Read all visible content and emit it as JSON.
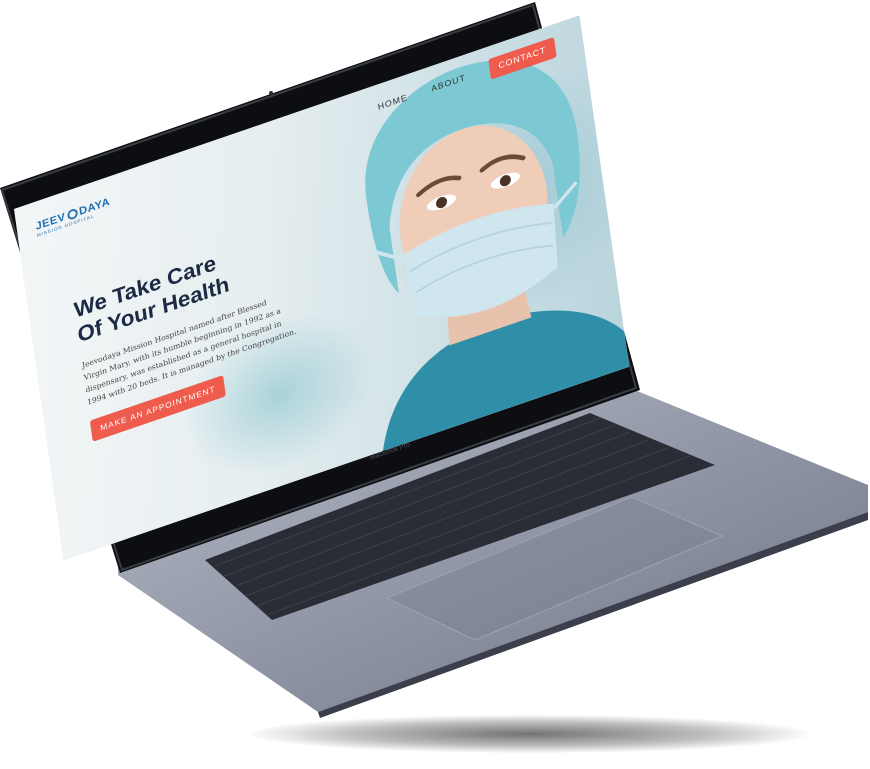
{
  "logo": {
    "name_left": "JEEV",
    "name_right": "DAYA",
    "subtitle": "MISSION HOSPITAL"
  },
  "nav": {
    "home": "HOME",
    "about": "ABOUT",
    "contact": "CONTACT"
  },
  "hero": {
    "title_line1": "We Take Care",
    "title_line2": "Of Your Health",
    "description": "Jeevodaya Mission Hospital named after Blessed Virgin Mary, with its humble beginning in 1992 as a dispensary, was established as a general hospital in 1994 with 20 beds. It is managed by the Congregation.",
    "cta": "MAKE AN APPOINTMENT"
  },
  "device": {
    "label": "MacBook Pro"
  },
  "colors": {
    "accent": "#ef5b4c",
    "heading": "#1d2a44",
    "logo": "#1f6fb2"
  }
}
